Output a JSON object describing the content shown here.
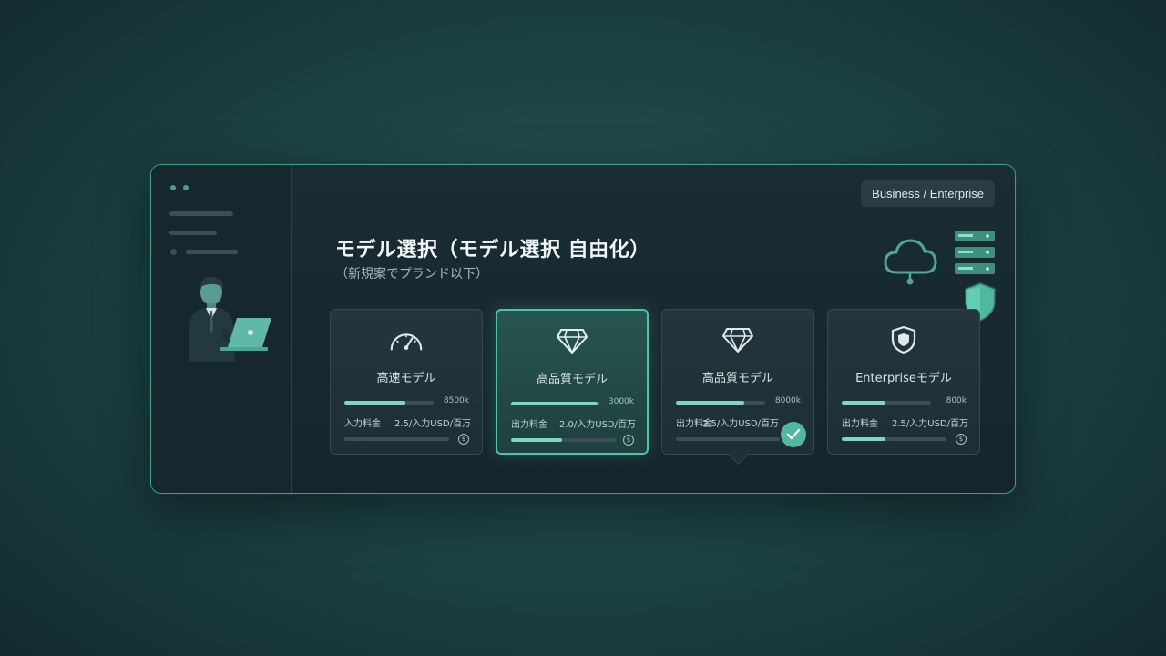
{
  "window": {
    "badge": "Business / Enterprise",
    "title": "モデル選択（モデル選択 自由化）",
    "subtitle": "（新規案でプランド以下）"
  },
  "cards": [
    {
      "name": "高速モデル",
      "metric": "8500k",
      "label": "入力料金",
      "price": "2.5/入力USD/百万",
      "bar1": 0.68,
      "bar2": 0,
      "icon": "speedometer-icon",
      "selected": false,
      "checked": false
    },
    {
      "name": "高品質モデル",
      "metric": "3000k",
      "label": "出力料金",
      "price": "2.0/入力USD/百万",
      "bar1": 0.97,
      "bar2": 0.49,
      "icon": "diamond-icon",
      "selected": true,
      "checked": false
    },
    {
      "name": "高品質モデル",
      "metric": "8000k",
      "label": "出力料金",
      "price": "2.5/入力USD/百万",
      "bar1": 0.77,
      "bar2": 0,
      "icon": "diamond-icon",
      "selected": false,
      "checked": true
    },
    {
      "name": "Enterpriseモデル",
      "metric": "800k",
      "label": "出力料金",
      "price": "2.5/入力USD/百万",
      "bar1": 0.49,
      "bar2": 0.42,
      "icon": "shield-icon",
      "selected": false,
      "checked": false
    }
  ],
  "colors": {
    "accent": "#4fc3a8",
    "bar": "#7fd6c3"
  }
}
